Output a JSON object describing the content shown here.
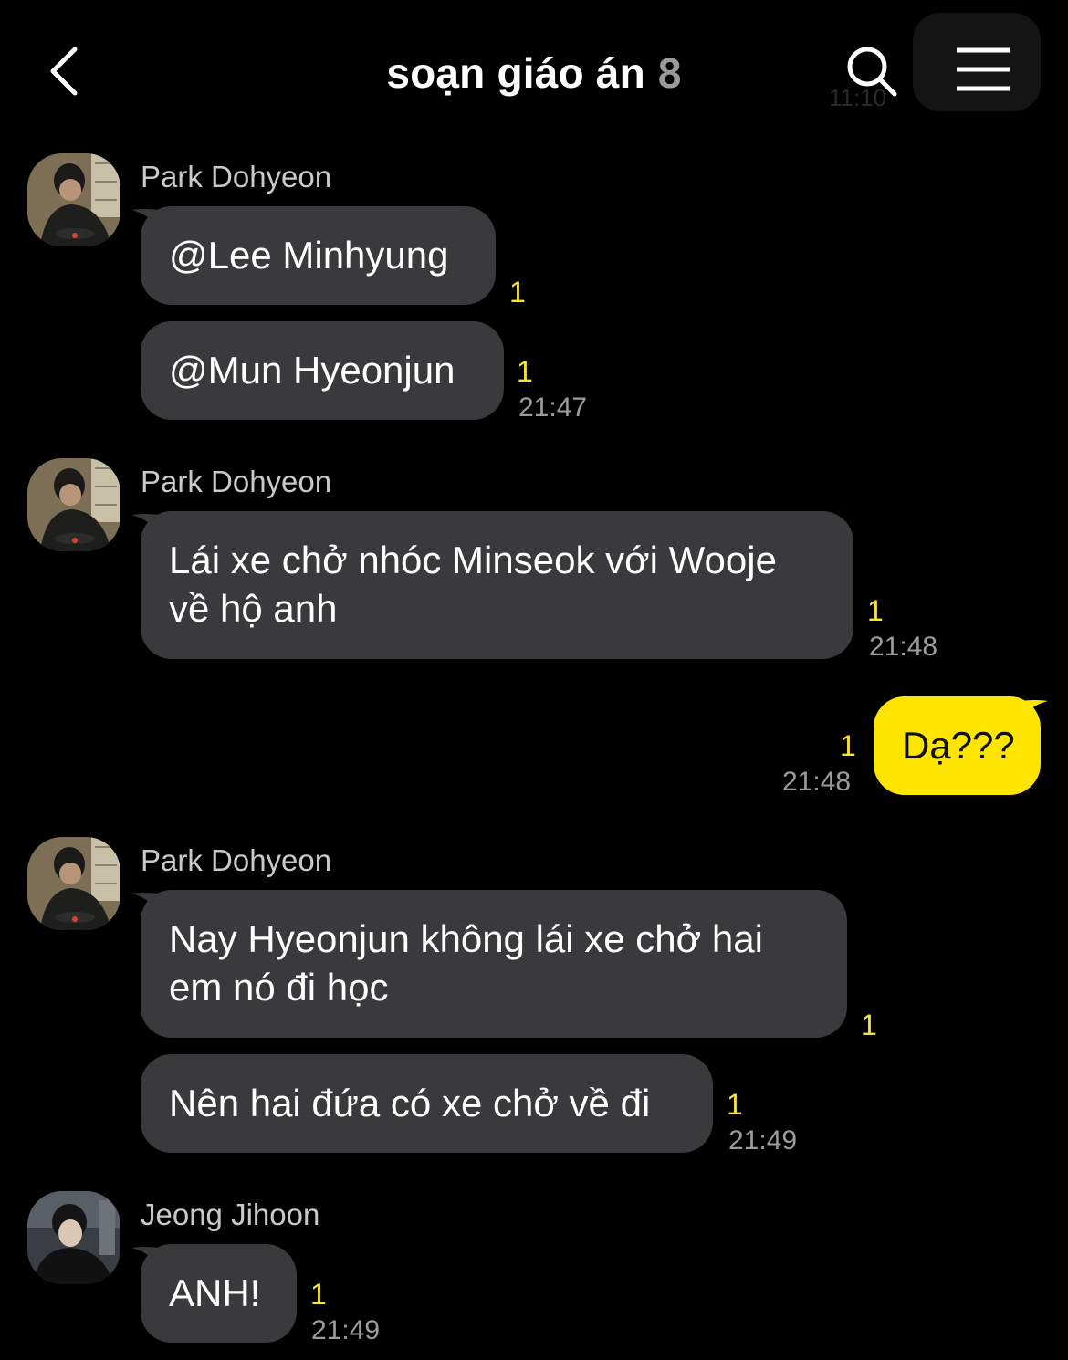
{
  "header": {
    "title": "soạn giáo án",
    "member_count": "8",
    "ghost_time": "11:10",
    "back_icon": "chevron-left-icon",
    "search_icon": "search-icon",
    "menu_icon": "hamburger-menu-icon"
  },
  "colors": {
    "background": "#000000",
    "bubble_other": "#3a3a3c",
    "bubble_mine": "#fee500",
    "unread": "#f7e33a",
    "time": "#9c9c9c"
  },
  "messages": [
    {
      "sender": "Park Dohyeon",
      "bubbles": [
        {
          "text": "@Lee Minhyung",
          "unread": "1"
        },
        {
          "text": "@Mun Hyeonjun",
          "unread": "1",
          "time": "21:47"
        }
      ]
    },
    {
      "sender": "Park Dohyeon",
      "bubbles": [
        {
          "line1": "Lái xe chở nhóc Minseok với Wooje",
          "line2": "về hộ anh",
          "unread": "1",
          "time": "21:48"
        }
      ]
    },
    {
      "sender": "me",
      "bubbles": [
        {
          "text": "Dạ???",
          "unread": "1",
          "time": "21:48"
        }
      ]
    },
    {
      "sender": "Park Dohyeon",
      "bubbles": [
        {
          "line1": "Nay Hyeonjun không lái xe chở hai",
          "line2": "em nó đi học",
          "unread": "1"
        },
        {
          "text": "Nên hai đứa có xe chở về đi",
          "unread": "1",
          "time": "21:49"
        }
      ]
    },
    {
      "sender": "Jeong Jihoon",
      "bubbles": [
        {
          "text": "ANH!",
          "unread": "1",
          "time": "21:49"
        }
      ]
    }
  ]
}
